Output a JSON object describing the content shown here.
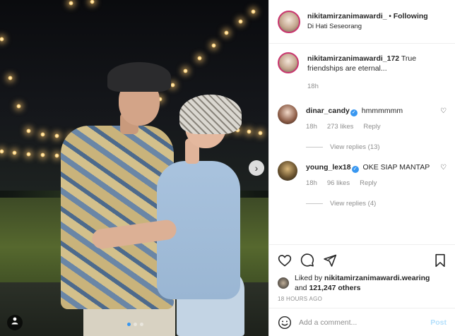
{
  "header": {
    "username": "nikitamirzanimawardi_",
    "separator": "•",
    "follow_label": "Following",
    "location": "Di Hati Seseorang"
  },
  "caption": {
    "username": "nikitamirzanimawardi_172",
    "text": "True friendships are eternal...",
    "time": "18h"
  },
  "comments": [
    {
      "username": "dinar_candy",
      "verified": true,
      "text": "hmmmmmm",
      "time": "18h",
      "likes": "273 likes",
      "reply_label": "Reply",
      "view_replies": "View replies (13)"
    },
    {
      "username": "young_lex18",
      "verified": true,
      "text": "OKE SIAP MANTAP",
      "time": "18h",
      "likes": "96 likes",
      "reply_label": "Reply",
      "view_replies": "View replies (4)"
    }
  ],
  "liked_by": {
    "prefix": "Liked by",
    "username": "nikitamirzanimawardi.wearing",
    "and": "and",
    "others": "121,247 others"
  },
  "time_ago": "18 HOURS AGO",
  "add_comment": {
    "placeholder": "Add a comment...",
    "post_label": "Post"
  },
  "icons": {
    "like": "heart-icon",
    "comment": "comment-icon",
    "share": "share-icon",
    "save": "bookmark-icon",
    "emoji": "emoji-icon",
    "next": "chevron-right-icon",
    "tag": "person-tag-icon"
  },
  "colors": {
    "accent": "#3897f0",
    "verified": "#3897f0",
    "post_disabled": "#b2dffc",
    "muted": "#8e8e8e"
  }
}
